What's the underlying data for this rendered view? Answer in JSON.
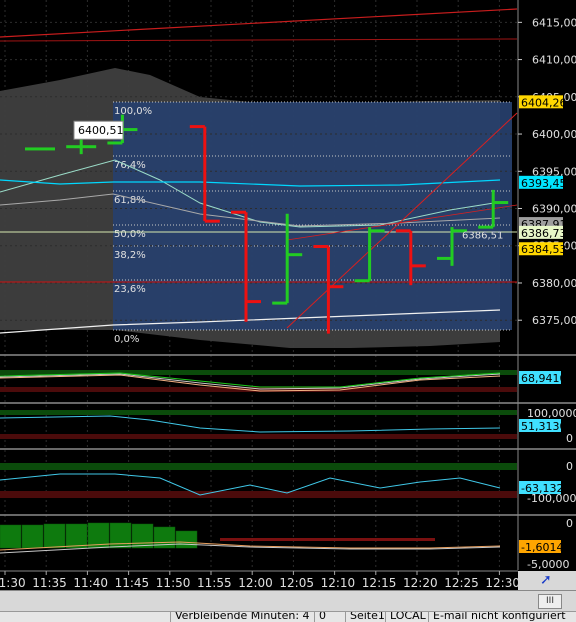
{
  "chart_data": {
    "type": "candlestick",
    "x_labels": [
      "11:30",
      "11:35",
      "11:40",
      "11:45",
      "11:50",
      "11:55",
      "12:00",
      "12:05",
      "12:10",
      "12:15",
      "12:20",
      "12:25",
      "12:30"
    ],
    "main_panel": {
      "y_ticks": [
        "6415,00",
        "6410,00",
        "6405,00",
        "6400,00",
        "6395,00",
        "6390,00",
        "6385,00",
        "6380,00",
        "6375,00"
      ],
      "y_range": [
        6371,
        6418
      ],
      "bars": [
        {
          "t": "11:30",
          "o": 6398,
          "h": 6398,
          "l": 6398,
          "c": 6398
        },
        {
          "t": "11:35",
          "o": 6398.3,
          "h": 6399.5,
          "l": 6397.3,
          "c": 6398.3
        },
        {
          "t": "11:40",
          "o": 6398.8,
          "h": 6402.6,
          "l": 6398.8,
          "c": 6400.6
        },
        {
          "t": "11:50",
          "o": 6401.0,
          "h": 6401.0,
          "l": 6388.3,
          "c": 6388.3
        },
        {
          "t": "11:55",
          "o": 6389.5,
          "h": 6389.5,
          "l": 6374.8,
          "c": 6377.5
        },
        {
          "t": "12:00",
          "o": 6377.3,
          "h": 6389.3,
          "l": 6377.3,
          "c": 6383.8
        },
        {
          "t": "12:05",
          "o": 6384.9,
          "h": 6384.9,
          "l": 6373.2,
          "c": 6379.5
        },
        {
          "t": "12:10",
          "o": 6380.3,
          "h": 6387.5,
          "l": 6380.3,
          "c": 6387.0
        },
        {
          "t": "12:15",
          "o": 6387.0,
          "h": 6387.0,
          "l": 6379.7,
          "c": 6382.3
        },
        {
          "t": "12:20",
          "o": 6383.3,
          "h": 6387.5,
          "l": 6382.3,
          "c": 6387.0
        },
        {
          "t": "12:25",
          "o": 6387.5,
          "h": 6392.5,
          "l": 6387.5,
          "c": 6390.8
        },
        {
          "t": "12:30",
          "o": 6390.8,
          "h": 6390.8,
          "l": 6384.5,
          "c": 6384.5
        }
      ],
      "fibonacci_levels": [
        "100,0%",
        "76,4%",
        "61,8%",
        "50,0%",
        "38,2%",
        "23,6%",
        "0,0%"
      ],
      "price_tags": [
        {
          "label": "6404,26",
          "price": 6404.26,
          "color": "#ffd700"
        },
        {
          "label": "6393,45",
          "price": 6393.45,
          "color": "#00e5ff"
        },
        {
          "label": "6387,91",
          "price": 6387.91,
          "color": "#9e9e9e"
        },
        {
          "label": "6386,73",
          "price": 6386.73,
          "color": "#e8f8c8"
        },
        {
          "label": "6384,53",
          "price": 6384.53,
          "color": "#ffd700"
        }
      ],
      "annotations": [
        {
          "text": "6400,51",
          "price": 6400.51
        },
        {
          "text": "6386,51",
          "price": 6386.51
        }
      ]
    },
    "indicator_panels": [
      {
        "value_tag": "68,9410",
        "ticks": []
      },
      {
        "value_tag": "51,3130",
        "ticks": [
          "100,0000",
          "0"
        ]
      },
      {
        "value_tag": "-63,1321",
        "ticks": [
          "0",
          "-100,0000"
        ]
      },
      {
        "value_tag": "-1,6014",
        "ticks": [
          "0",
          "-5,0000"
        ]
      }
    ]
  },
  "status_bar": {
    "remaining": "Verbleibende Minuten: 4",
    "zero": "0",
    "page": "Seite1",
    "local": "LOCAL",
    "email": "E-mail nicht konfiguriert"
  },
  "scroll_label": "III",
  "colors": {
    "up_bar": "#22cc22",
    "down_bar": "#ee1111",
    "fib_box": "#27406e",
    "axis_bg": "#000000"
  }
}
